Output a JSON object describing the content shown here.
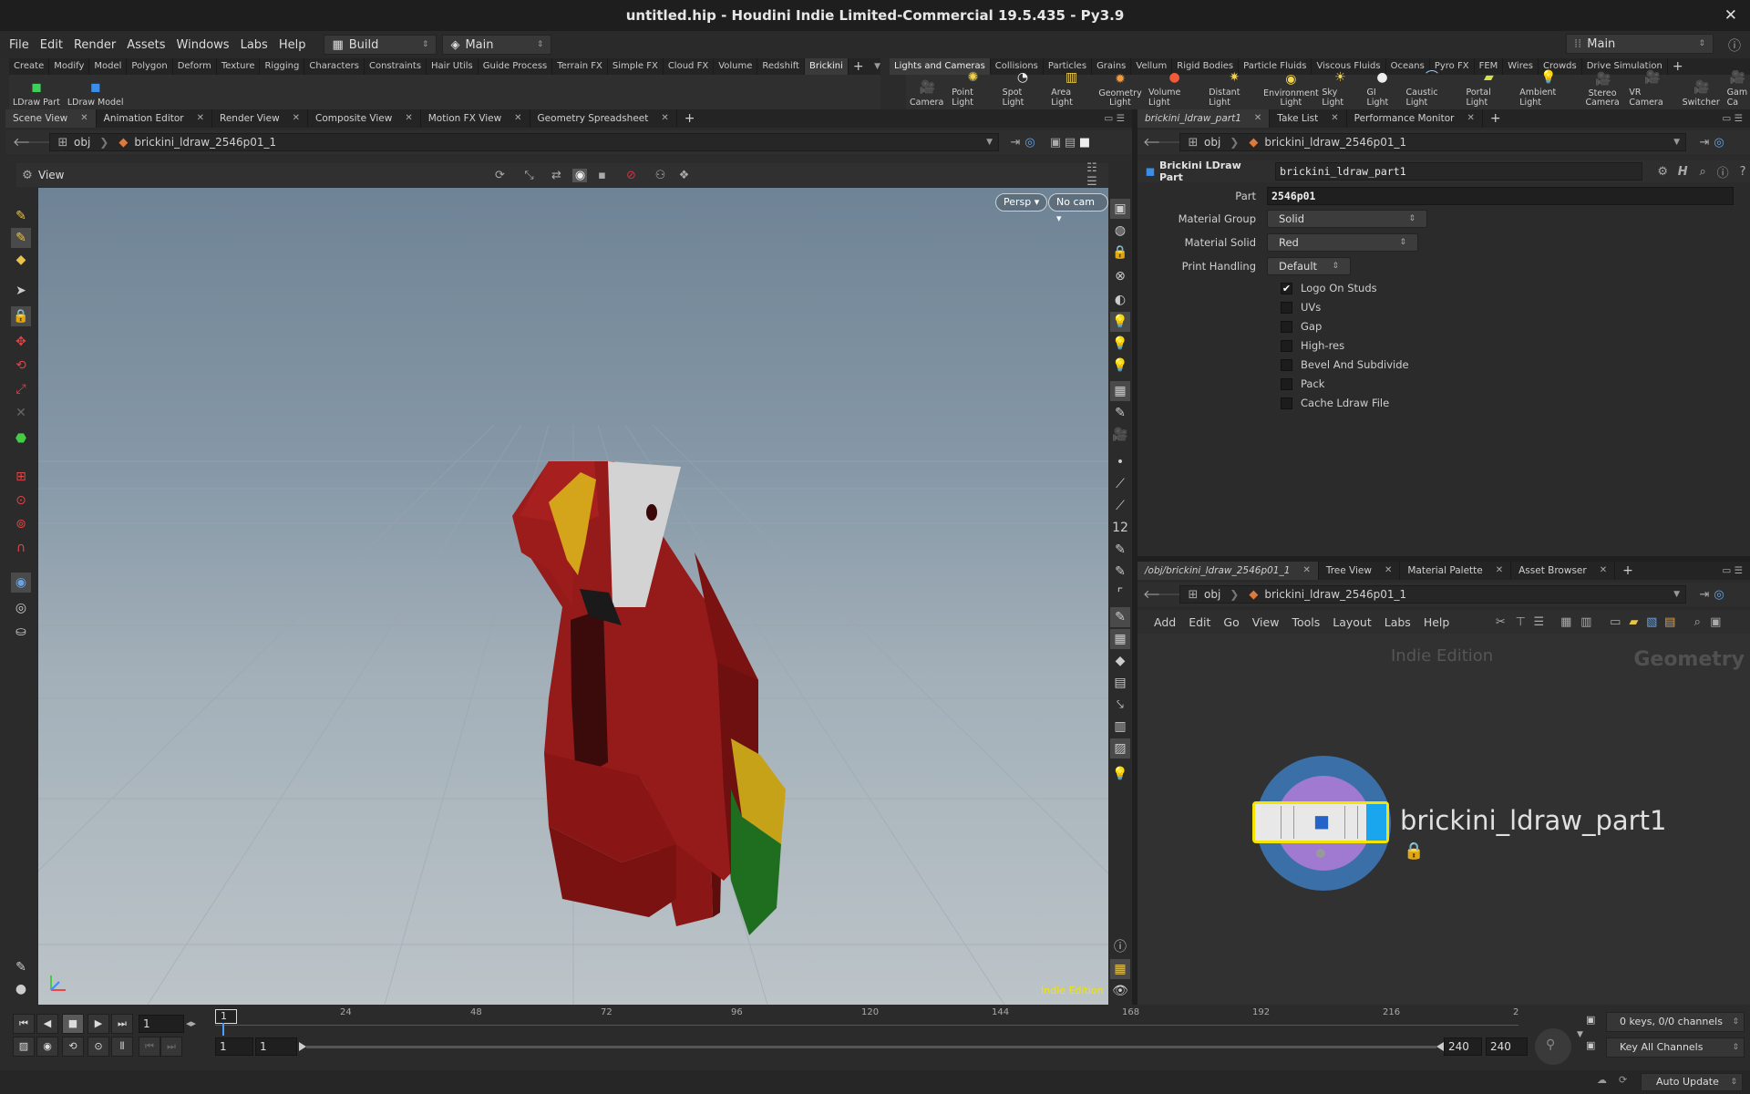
{
  "title": "untitled.hip - Houdini Indie Limited-Commercial 19.5.435 - Py3.9",
  "menubar": [
    "File",
    "Edit",
    "Render",
    "Assets",
    "Windows",
    "Labs",
    "Help"
  ],
  "desktop": "Build",
  "context": "Main",
  "context_right": "Main",
  "shelf_left_tabs": [
    "Create",
    "Modify",
    "Model",
    "Polygon",
    "Deform",
    "Texture",
    "Rigging",
    "Characters",
    "Constraints",
    "Hair Utils",
    "Guide Process",
    "Terrain FX",
    "Simple FX",
    "Cloud FX",
    "Volume",
    "Redshift",
    "Brickini"
  ],
  "shelf_left_selected": "Brickini",
  "shelf_left_tools": [
    "LDraw Part",
    "LDraw Model"
  ],
  "shelf_right_tabs": [
    "Lights and Cameras",
    "Collisions",
    "Particles",
    "Grains",
    "Vellum",
    "Rigid Bodies",
    "Particle Fluids",
    "Viscous Fluids",
    "Oceans",
    "Pyro FX",
    "FEM",
    "Wires",
    "Crowds",
    "Drive Simulation"
  ],
  "shelf_right_selected": "Lights and Cameras",
  "shelf_right_tools": [
    "Camera",
    "Point Light",
    "Spot Light",
    "Area Light",
    "Geometry Light",
    "Volume Light",
    "Distant Light",
    "Environment Light",
    "Sky Light",
    "GI Light",
    "Caustic Light",
    "Portal Light",
    "Ambient Light",
    "Stereo Camera",
    "VR Camera",
    "Switcher",
    "Gam Ca"
  ],
  "left_pane_tabs": [
    "Scene View",
    "Animation Editor",
    "Render View",
    "Composite View",
    "Motion FX View",
    "Geometry Spreadsheet"
  ],
  "path_root": "obj",
  "path_node": "brickini_ldraw_2546p01_1",
  "view_label": "View",
  "viewport": {
    "persp": "Persp",
    "cam": "No cam",
    "watermark": "Indie Edition"
  },
  "param_tabs": [
    "brickini_ldraw_part1",
    "Take List",
    "Performance Monitor"
  ],
  "node_type": "Brickini LDraw Part",
  "node_name": "brickini_ldraw_part1",
  "params": {
    "part_label": "Part",
    "part_value": "2546p01",
    "material_group_label": "Material Group",
    "material_group_value": "Solid",
    "material_solid_label": "Material Solid",
    "material_solid_value": "Red",
    "print_handling_label": "Print Handling",
    "print_handling_value": "Default"
  },
  "checkboxes": [
    {
      "label": "Logo On Studs",
      "checked": true
    },
    {
      "label": "UVs",
      "checked": false
    },
    {
      "label": "Gap",
      "checked": false
    },
    {
      "label": "High-res",
      "checked": false
    },
    {
      "label": "Bevel And Subdivide",
      "checked": false
    },
    {
      "label": "Pack",
      "checked": false
    },
    {
      "label": "Cache Ldraw File",
      "checked": false
    }
  ],
  "network_tabs": [
    "/obj/brickini_ldraw_2546p01_1",
    "Tree View",
    "Material Palette",
    "Asset Browser"
  ],
  "network_menu": [
    "Add",
    "Edit",
    "Go",
    "View",
    "Tools",
    "Layout",
    "Labs",
    "Help"
  ],
  "network": {
    "edition": "Indie Edition",
    "context": "Geometry",
    "node_label": "brickini_ldraw_part1"
  },
  "timeline": {
    "frame": "1",
    "marker": "1",
    "ticks": [
      "24",
      "48",
      "72",
      "96",
      "120",
      "144",
      "168",
      "192",
      "216",
      "2"
    ],
    "range_start": "1",
    "range_start2": "1",
    "range_end": "240",
    "range_end2": "240",
    "keys": "0 keys, 0/0 channels",
    "key_all": "Key All Channels",
    "auto_update": "Auto Update"
  },
  "colors": {
    "parrot_red": "#8e1a1a",
    "accent_yellow": "#f5e400",
    "node_blue": "#1aa6ef"
  }
}
